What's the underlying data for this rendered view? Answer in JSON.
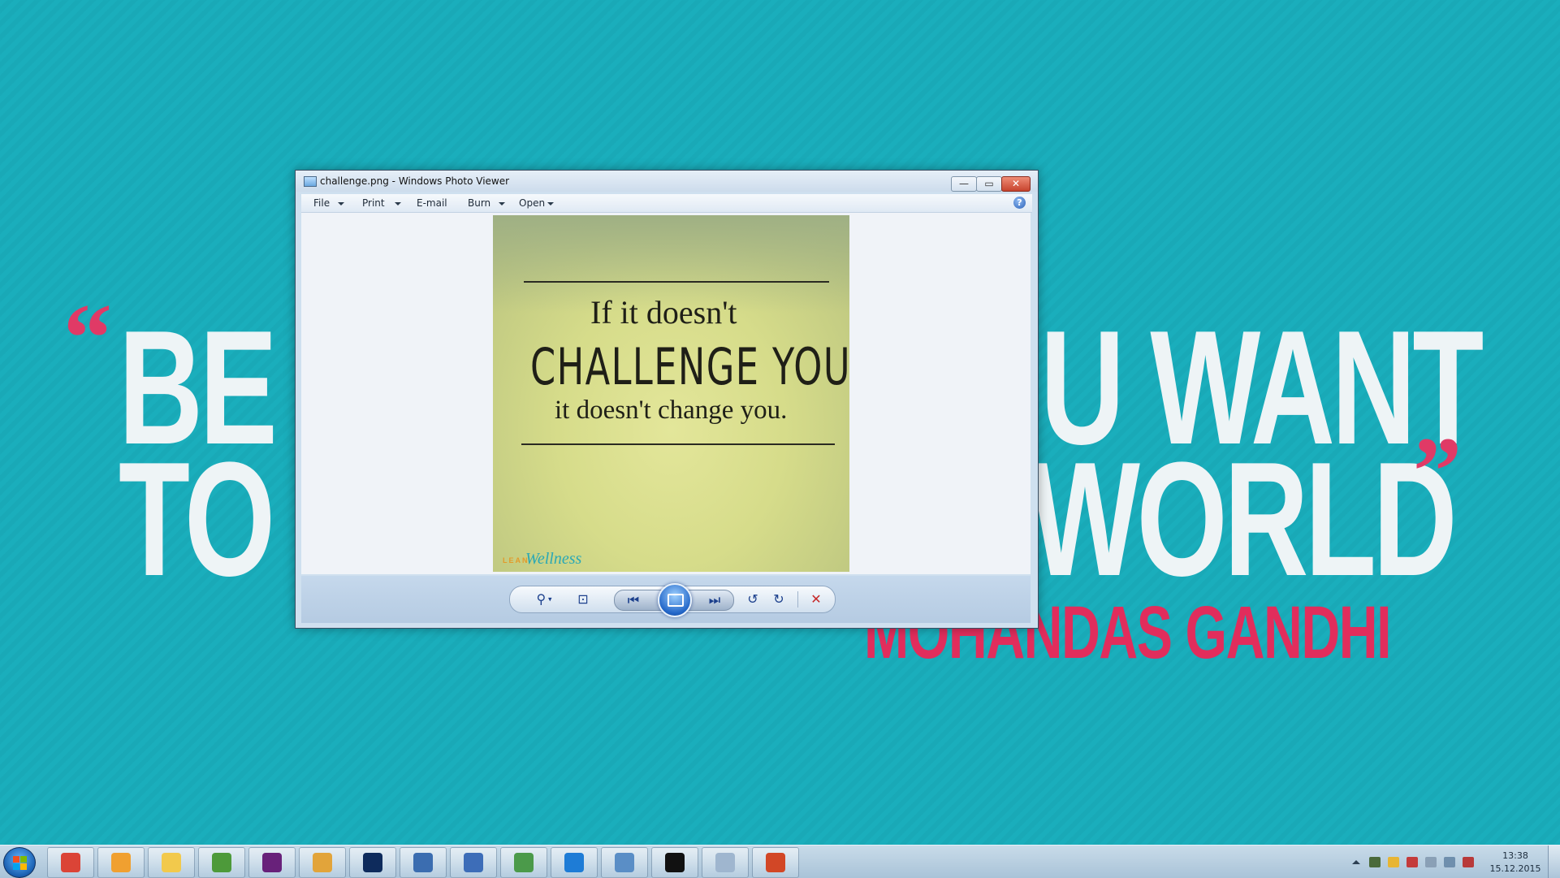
{
  "wallpaper": {
    "line1": "BE T",
    "line1_right": "U WANT",
    "line2": "TO",
    "line2_right": "WORLD",
    "open_quote": "“",
    "close_quote": "”",
    "author": "MOHANDAS GANDHI",
    "accent_color": "#e12d5c"
  },
  "window": {
    "title": "challenge.png - Windows Photo Viewer",
    "controls": {
      "minimize": "—",
      "maximize": "▭",
      "close": "✕"
    },
    "menu": [
      {
        "label": "File"
      },
      {
        "label": "Print"
      },
      {
        "label": "E-mail"
      },
      {
        "label": "Burn"
      },
      {
        "label": "Open"
      }
    ],
    "help": "?",
    "photo": {
      "line1": "If it doesn't",
      "line2": "CHALLENGE YOU",
      "line3": "it doesn't change you.",
      "brand_small": "LEAN",
      "brand_script": "Wellness"
    },
    "toolbar": {
      "zoom": "⚲",
      "fit": "⊡",
      "previous": "⏮",
      "next": "⏭",
      "rotate_ccw": "↺",
      "rotate_cw": "↻",
      "delete": "✕"
    }
  },
  "taskbar": {
    "apps": [
      {
        "name": "chrome",
        "color": "#db4437"
      },
      {
        "name": "outlook",
        "color": "#f0a030"
      },
      {
        "name": "explorer",
        "color": "#f2c94c"
      },
      {
        "name": "project",
        "color": "#4d9a3a"
      },
      {
        "name": "visual-studio",
        "color": "#68217a"
      },
      {
        "name": "tool",
        "color": "#e2a43a"
      },
      {
        "name": "vs-code",
        "color": "#0e2b5c"
      },
      {
        "name": "editor",
        "color": "#3b6db0"
      },
      {
        "name": "network",
        "color": "#3d6db8"
      },
      {
        "name": "tools",
        "color": "#4b9a4a"
      },
      {
        "name": "wifi",
        "color": "#1e7cd6"
      },
      {
        "name": "photo-viewer",
        "color": "#5a8ec6"
      },
      {
        "name": "cmd",
        "color": "#111111"
      },
      {
        "name": "calculator",
        "color": "#9fb6cf"
      },
      {
        "name": "powerpoint",
        "color": "#d24726"
      }
    ],
    "clock_time": "13:38",
    "clock_date": "15.12.2015"
  }
}
